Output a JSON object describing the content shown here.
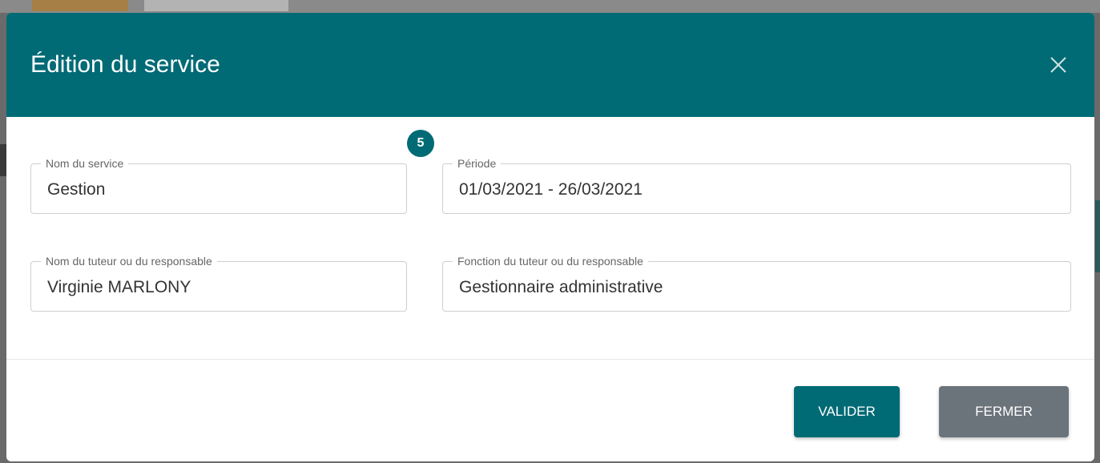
{
  "modal": {
    "title": "Édition du service",
    "close_icon": "close-icon",
    "step_badge": "5"
  },
  "form": {
    "nom_service": {
      "label": "Nom du service",
      "value": "Gestion"
    },
    "periode": {
      "label": "Période",
      "value": "01/03/2021 - 26/03/2021"
    },
    "tuteur_nom": {
      "label": "Nom du tuteur ou du responsable",
      "value": "Virginie MARLONY"
    },
    "tuteur_fonction": {
      "label": "Fonction du tuteur ou du responsable",
      "value": "Gestionnaire administrative"
    }
  },
  "footer": {
    "valider_label": "VALIDER",
    "fermer_label": "FERMER"
  },
  "colors": {
    "header_bg": "#006a75",
    "primary_button": "#006a75",
    "secondary_button": "#6b737b"
  }
}
